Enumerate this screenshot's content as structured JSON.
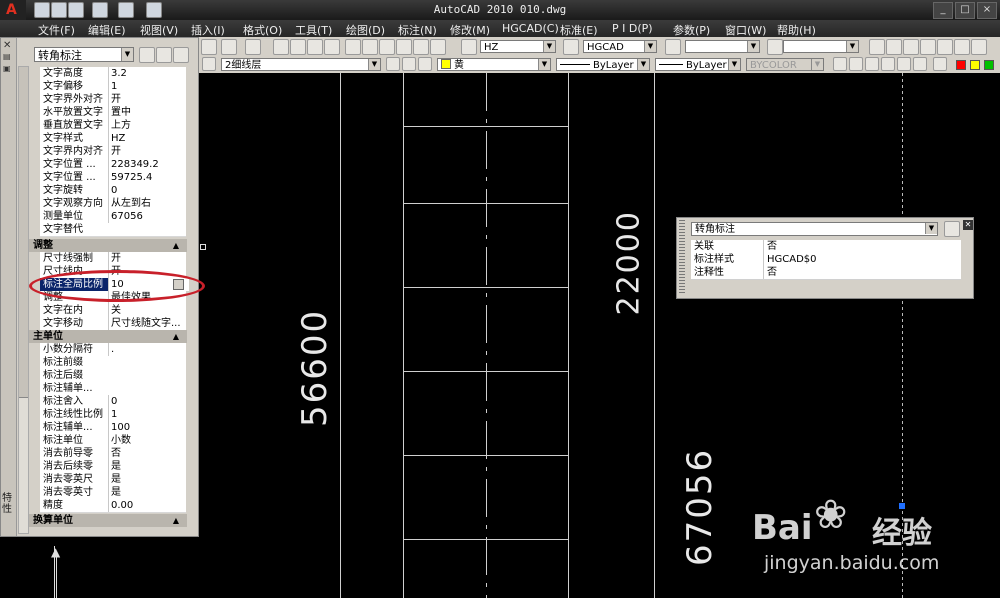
{
  "window": {
    "title": "AutoCAD 2010   010.dwg"
  },
  "menubar": {
    "items": [
      "文件(F)",
      "编辑(E)",
      "视图(V)",
      "插入(I)",
      "格式(O)",
      "工具(T)",
      "绘图(D)",
      "标注(N)",
      "修改(M)",
      "HGCAD(C)",
      "标准(E)",
      "P I D(P)",
      "参数(P)",
      "窗口(W)",
      "帮助(H)"
    ]
  },
  "toolbar": {
    "text_style": "HZ",
    "dim_style": "HGCAD",
    "layer": "2细线层",
    "color": "黄",
    "linetype": "ByLayer",
    "lineweight": "ByLayer",
    "plotstyle": "BYCOLOR"
  },
  "palette": {
    "object_type": "转角标注",
    "side_label": "特性",
    "rows_text": [
      {
        "k": "文字高度",
        "v": "3.2"
      },
      {
        "k": "文字偏移",
        "v": "1"
      },
      {
        "k": "文字界外对齐",
        "v": "开"
      },
      {
        "k": "水平放置文字",
        "v": "置中"
      },
      {
        "k": "垂直放置文字",
        "v": "上方"
      },
      {
        "k": "文字样式",
        "v": "HZ"
      },
      {
        "k": "文字界内对齐",
        "v": "开"
      },
      {
        "k": "文字位置 ...",
        "v": "228349.2"
      },
      {
        "k": "文字位置 ...",
        "v": "59725.4"
      },
      {
        "k": "文字旋转",
        "v": "0"
      },
      {
        "k": "文字观察方向",
        "v": "从左到右"
      },
      {
        "k": "测量单位",
        "v": "67056"
      },
      {
        "k": "文字替代",
        "v": ""
      }
    ],
    "section_adjust": "调整",
    "rows_adjust": [
      {
        "k": "尺寸线强制",
        "v": "开"
      },
      {
        "k": "尺寸线内",
        "v": "开"
      },
      {
        "k": "标注全局比例",
        "v": "10"
      },
      {
        "k": "调整",
        "v": "最佳效果"
      },
      {
        "k": "文字在内",
        "v": "关"
      },
      {
        "k": "文字移动",
        "v": "尺寸线随文字..."
      }
    ],
    "section_primary": "主单位",
    "rows_primary": [
      {
        "k": "小数分隔符",
        "v": "."
      },
      {
        "k": "标注前缀",
        "v": ""
      },
      {
        "k": "标注后缀",
        "v": ""
      },
      {
        "k": "标注辅单...",
        "v": ""
      },
      {
        "k": "标注舍入",
        "v": "0"
      },
      {
        "k": "标注线性比例",
        "v": "1"
      },
      {
        "k": "标注辅单...",
        "v": "100"
      },
      {
        "k": "标注单位",
        "v": "小数"
      },
      {
        "k": "消去前导零",
        "v": "否"
      },
      {
        "k": "消去后续零",
        "v": "是"
      },
      {
        "k": "消去零英尺",
        "v": "是"
      },
      {
        "k": "消去零英寸",
        "v": "是"
      },
      {
        "k": "精度",
        "v": "0.00"
      }
    ],
    "section_alt": "换算单位"
  },
  "quick": {
    "object_type": "转角标注",
    "rows": [
      {
        "k": "关联",
        "v": "否"
      },
      {
        "k": "标注样式",
        "v": "HGCAD$0"
      },
      {
        "k": "注释性",
        "v": "否"
      }
    ]
  },
  "drawing": {
    "dims": [
      "56600",
      "22000",
      "67056"
    ]
  },
  "watermark": {
    "brand": "Bai",
    "brand2": "经验",
    "url": "jingyan.baidu.com"
  }
}
